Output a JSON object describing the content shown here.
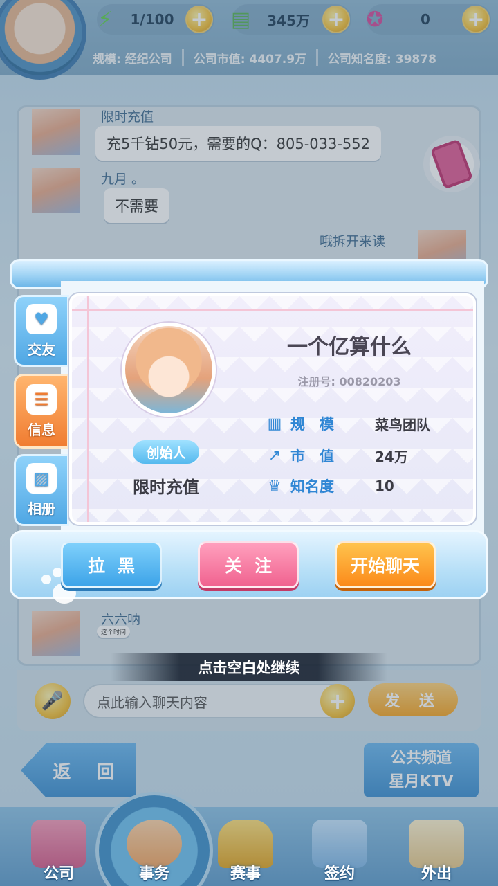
{
  "topbar": {
    "energy": "1/100",
    "cash": "345万",
    "gems": "0",
    "scale": "规模: 经纪公司",
    "market_value": "公司市值: 4407.9万",
    "fame": "公司知名度: 39878"
  },
  "chat": {
    "messages": [
      {
        "name": "限时充值",
        "text": "充5千钻50元，需要的Q：805-033-552"
      },
      {
        "name": "九月 。",
        "text": "不需要"
      },
      {
        "name": "哦拆开来读",
        "text": ""
      },
      {
        "name": "六六呐",
        "text": "这个时间"
      }
    ],
    "input_placeholder": "点此输入聊天内容",
    "send_label": "发 送"
  },
  "nav": {
    "back_label": "返 回",
    "channel_line1": "公共频道",
    "channel_line2": "星月KTV"
  },
  "bottom_nav": [
    {
      "label": "公司"
    },
    {
      "label": "事务"
    },
    {
      "label": "赛事"
    },
    {
      "label": "签约"
    },
    {
      "label": "外出"
    }
  ],
  "modal": {
    "tabs": [
      {
        "label": "交友",
        "icon": "heart-chat-icon"
      },
      {
        "label": "信息",
        "icon": "document-icon"
      },
      {
        "label": "相册",
        "icon": "picture-icon"
      }
    ],
    "active_tab": "信息",
    "profile": {
      "name": "一个亿算什么",
      "reg_no": "注册号: 00820203",
      "role_badge": "创始人",
      "tag": "限时充值",
      "stats": [
        {
          "label": "规　模",
          "value": "菜鸟团队",
          "icon": "building-icon"
        },
        {
          "label": "市　值",
          "value": "24万",
          "icon": "trend-up-icon"
        },
        {
          "label": "知名度",
          "value": "10",
          "icon": "crown-icon"
        }
      ]
    },
    "buttons": {
      "block": "拉黑",
      "follow": "关注",
      "chat": "开始聊天"
    }
  },
  "hint": "点击空白处继续",
  "colors": {
    "accent_blue": "#3ca3e8",
    "accent_pink": "#f0628f",
    "accent_orange": "#fb8a1a",
    "stat_label": "#2f86d4"
  }
}
